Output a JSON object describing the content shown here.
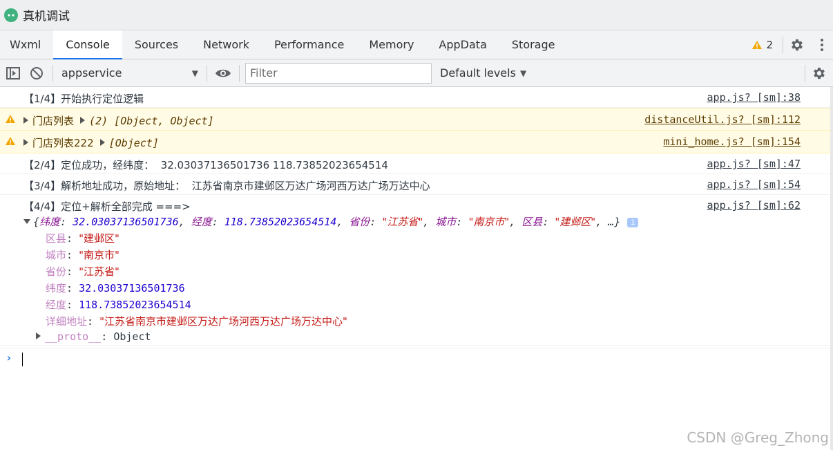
{
  "window": {
    "title": "真机调试"
  },
  "tabs": [
    {
      "label": "Wxml"
    },
    {
      "label": "Console",
      "active": true
    },
    {
      "label": "Sources"
    },
    {
      "label": "Network"
    },
    {
      "label": "Performance"
    },
    {
      "label": "Memory"
    },
    {
      "label": "AppData"
    },
    {
      "label": "Storage"
    }
  ],
  "warnings": {
    "count": "2"
  },
  "toolbar": {
    "context": "appservice",
    "filter_placeholder": "Filter",
    "levels": "Default levels"
  },
  "messages": [
    {
      "text": "【1/4】开始执行定位逻辑",
      "source": "app.js? [sm]:38"
    },
    {
      "label": "门店列表",
      "value": "(2) [Object, Object]",
      "source": "distanceUtil.js? [sm]:112",
      "level": "warning"
    },
    {
      "label": "门店列表222",
      "value": "[Object]",
      "source": "mini_home.js? [sm]:154",
      "level": "warning"
    },
    {
      "text": "【2/4】定位成功，经纬度：  32.03037136501736 118.73852023654514",
      "source": "app.js? [sm]:47"
    },
    {
      "text": "【3/4】解析地址成功，原始地址：  江苏省南京市建邺区万达广场河西万达广场万达中心",
      "source": "app.js? [sm]:54"
    },
    {
      "text": "【4/4】定位+解析全部完成 ===>",
      "source": "app.js? [sm]:62"
    }
  ],
  "object_summary": {
    "k1": "纬度",
    "v1": "32.03037136501736",
    "k2": "经度",
    "v2": "118.73852023654514",
    "k3": "省份",
    "v3": "\"江苏省\"",
    "k4": "城市",
    "v4": "\"南京市\"",
    "k5": "区县",
    "v5": "\"建邺区\"",
    "tail": ", …}"
  },
  "object_props": [
    {
      "key": "区县",
      "value": "\"建邺区\"",
      "type": "string"
    },
    {
      "key": "城市",
      "value": "\"南京市\"",
      "type": "string"
    },
    {
      "key": "省份",
      "value": "\"江苏省\"",
      "type": "string"
    },
    {
      "key": "纬度",
      "value": "32.03037136501736",
      "type": "number"
    },
    {
      "key": "经度",
      "value": "118.73852023654514",
      "type": "number"
    },
    {
      "key": "详细地址",
      "value": "\"江苏省南京市建邺区万达广场河西万达广场万达中心\"",
      "type": "string"
    }
  ],
  "proto": {
    "key": "__proto__",
    "value": "Object"
  },
  "watermark": "CSDN @Greg_Zhong",
  "colors": {
    "accent": "#1a73e8",
    "warning_bg": "#fffbe5",
    "warning_icon": "#f2a600"
  },
  "icons": [
    "mini-program-icon",
    "warning-icon",
    "gear-icon",
    "kebab-menu-icon",
    "sidebar-toggle-icon",
    "clear-console-icon",
    "eye-icon",
    "info-icon",
    "prompt-chevron-icon"
  ]
}
